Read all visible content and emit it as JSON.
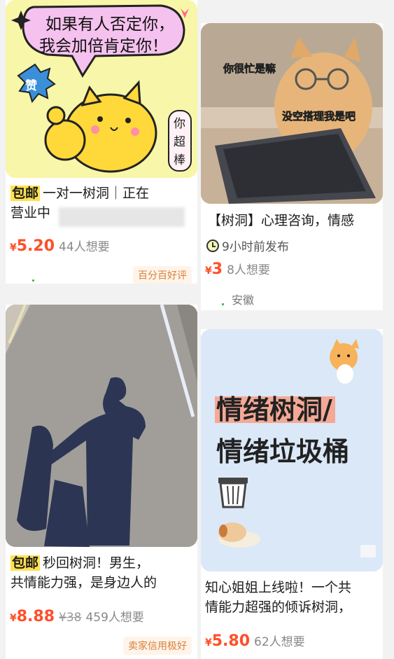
{
  "cards": [
    {
      "image_text": {
        "bubble_line1": "如果有人否定你，",
        "bubble_line2": "我会加倍肯定你！",
        "badge": "赞",
        "side": "你超棒"
      },
      "baoyou": "包邮",
      "title_line1": "一对一树洞｜正在",
      "title_line2": "营业中",
      "price_yen": "¥",
      "price": "5.20",
      "want": "44人想要",
      "tag": "百分百好评"
    },
    {
      "image_text": {
        "caption1": "你很忙是嘛",
        "caption2": "没空搭理我是吧"
      },
      "title": "【树洞】心理咨询，情感",
      "time_text": "9小时前发布",
      "price_yen": "¥",
      "price": "3",
      "want": "8人想要",
      "location": "安徽"
    },
    {
      "baoyou": "包邮",
      "title_line1": "秒回树洞！男生，",
      "title_line2": "共情能力强，是身边人的",
      "price_yen": "¥",
      "price": "8.88",
      "original_price": "¥38",
      "want": "459人想要",
      "tag": "卖家信用极好"
    },
    {
      "image_text": {
        "line1": "情绪树洞/",
        "line2": "情绪垃圾桶"
      },
      "title_line1": "知心姐姐上线啦！一个共",
      "title_line2": "情能力超强的倾诉树洞，",
      "price_yen": "¥",
      "price": "5.80",
      "want": "62人想要"
    }
  ]
}
